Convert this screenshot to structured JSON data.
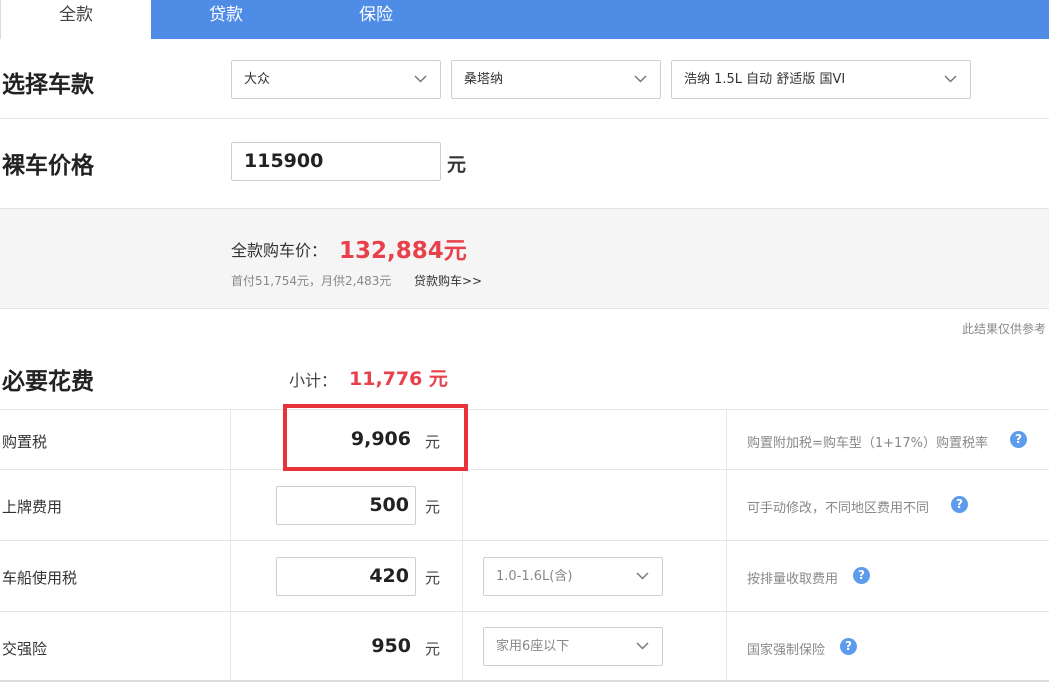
{
  "tabs": [
    {
      "label": "全款",
      "active": true
    },
    {
      "label": "贷款",
      "active": false
    },
    {
      "label": "保险",
      "active": false
    }
  ],
  "select_car": {
    "title": "选择车款",
    "brand": "大众",
    "series": "桑塔纳",
    "model": "浩纳 1.5L 自动 舒适版 国VI"
  },
  "bare_price": {
    "title": "裸车价格",
    "value": "115900",
    "unit": "元"
  },
  "summary": {
    "label": "全款购车价：",
    "price": "132,884元",
    "sub": "首付51,754元，月供2,483元",
    "loan_link": "贷款购车>>"
  },
  "note": "此结果仅供参考",
  "required": {
    "title": "必要花费",
    "subtotal_label": "小计：",
    "subtotal_value": "11,776 元",
    "rows": [
      {
        "label": "购置税",
        "value": "9,906",
        "unit": "元",
        "hint": "购置附加税=购车型（1+17%）购置税率"
      },
      {
        "label": "上牌费用",
        "value": "500",
        "unit": "元",
        "hint": "可手动修改，不同地区费用不同"
      },
      {
        "label": "车船使用税",
        "value": "420",
        "unit": "元",
        "option": "1.0-1.6L(含)",
        "hint": "按排量收取费用"
      },
      {
        "label": "交强险",
        "value": "950",
        "unit": "元",
        "option": "家用6座以下",
        "hint": "国家强制保险"
      }
    ]
  },
  "colors": {
    "tab_bar": "#4f8ce6",
    "price_red": "#e8414b",
    "highlight_red": "#e8333b",
    "help_blue": "#5d9cec"
  },
  "icons": {
    "dropdown": "chevron-down-icon",
    "help": "question-circle-icon"
  },
  "help_glyph": "?"
}
